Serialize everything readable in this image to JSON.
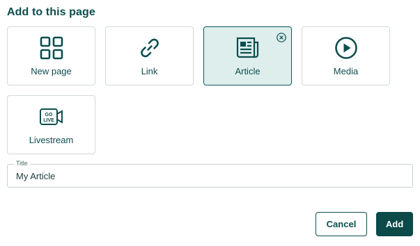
{
  "heading": "Add to this page",
  "tiles": [
    {
      "label": "New page",
      "icon": "grid-icon"
    },
    {
      "label": "Link",
      "icon": "link-icon"
    },
    {
      "label": "Article",
      "icon": "article-icon",
      "selected": true
    },
    {
      "label": "Media",
      "icon": "play-icon"
    },
    {
      "label": "Livestream",
      "icon": "go-live-icon",
      "badge": "GO LIVE"
    }
  ],
  "title_field": {
    "label": "Title",
    "value": "My Article"
  },
  "buttons": {
    "cancel": "Cancel",
    "add": "Add"
  },
  "colors": {
    "primary": "#0c4a4a",
    "selected_bg": "#ddeeed",
    "border": "#d2d9d9"
  }
}
